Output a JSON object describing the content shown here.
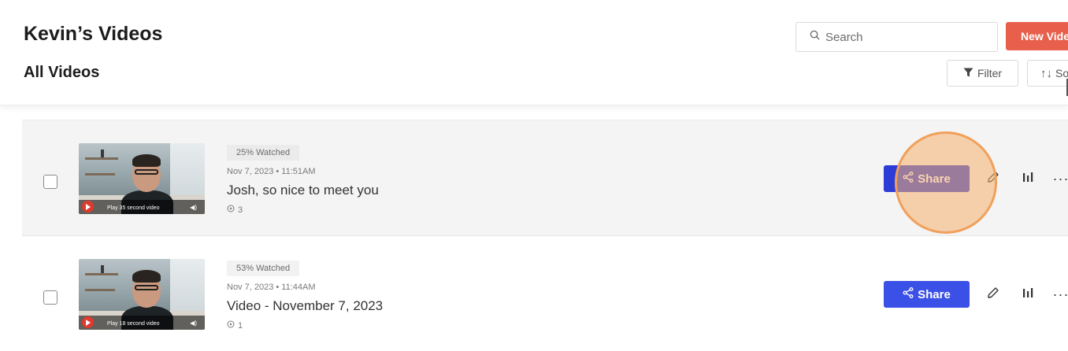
{
  "header": {
    "page_title": "Kevin’s Videos",
    "section_title": "All Videos",
    "search_placeholder": "Search",
    "new_video_label": "New Video",
    "filter_label": "Filter",
    "sort_label": "Sort"
  },
  "colors": {
    "primary_button": "#3b50e6",
    "new_video_button": "#e8604c",
    "highlight_ring": "#f0a05a"
  },
  "videos": [
    {
      "watched": "25% Watched",
      "date": "Nov 7, 2023 • 11:51AM",
      "title": "Josh, so nice to meet you",
      "views": "3",
      "thumbnail_label": "Play 35 second video",
      "share_label": "Share"
    },
    {
      "watched": "53% Watched",
      "date": "Nov 7, 2023 • 11:44AM",
      "title": "Video - November 7, 2023",
      "views": "1",
      "thumbnail_label": "Play 18 second video",
      "share_label": "Share"
    }
  ],
  "icons": [
    "search-icon",
    "filter-icon",
    "sort-icon",
    "share-icon",
    "pencil-icon",
    "bar-chart-icon",
    "more-icon",
    "play-icon",
    "eye-icon"
  ]
}
